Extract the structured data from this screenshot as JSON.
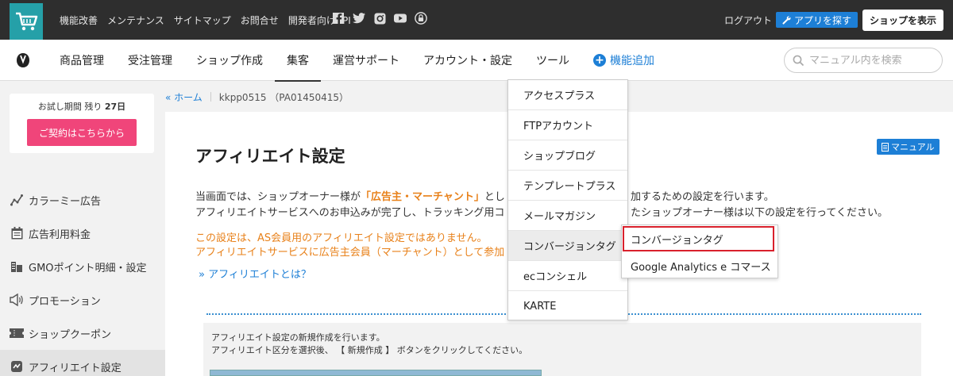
{
  "topbar": {
    "links": [
      "機能改善",
      "メンテナンス",
      "サイトマップ",
      "お問合せ",
      "開発者向けAPI"
    ],
    "sns_icons": [
      "facebook-icon",
      "twitter-icon",
      "instagram-icon",
      "youtube-icon",
      "lock-icon"
    ],
    "logout": "ログアウト",
    "app_button": "アプリを探す",
    "shop_button": "ショップを表示"
  },
  "nav": {
    "items": [
      "商品管理",
      "受注管理",
      "ショップ作成",
      "集客",
      "運営サポート",
      "アカウント・設定",
      "ツール"
    ],
    "active": "集客",
    "add_feature": "機能追加",
    "search_placeholder": "マニュアル内を検索"
  },
  "sidebar": {
    "trial_prefix": "お試し期間 残り",
    "trial_days": "27日",
    "contract_button": "ご契約はこちらから",
    "items": [
      {
        "label": "カラーミー広告",
        "icon": "chart-line-icon"
      },
      {
        "label": "広告利用料金",
        "icon": "calendar-icon"
      },
      {
        "label": "GMOポイント明細・設定",
        "icon": "coins-icon"
      },
      {
        "label": "プロモーション",
        "icon": "megaphone-icon"
      },
      {
        "label": "ショップクーポン",
        "icon": "coupon-icon"
      },
      {
        "label": "アフィリエイト設定",
        "icon": "affiliate-icon"
      }
    ],
    "active_item": "アフィリエイト設定"
  },
  "breadcrumb": {
    "home": "« ホーム",
    "current": "kkpp0515 （PA01450415）"
  },
  "main": {
    "title": "アフィリエイト設定",
    "manual_button": "マニュアル",
    "desc1_pre": "当画面では、ショップオーナー様が",
    "desc1_hl": "「広告主・マーチャント」",
    "desc1_post": "とし",
    "desc1_tail": "加するための設定を行います。",
    "desc2_pre": "アフィリエイトサービスへのお申込みが完了し、トラッキング用コ",
    "desc2_tail": "たショップオーナー様は以下の設定を行ってください。",
    "warn1": "この設定は、AS会員用のアフィリエイト設定ではありません。",
    "warn2": "アフィリエイトサービスに広告主会員（マーチャント）として参加",
    "whatis": "» アフィリエイトとは？",
    "info1": "アフィリエイト設定の新規作成を行います。",
    "info2": "アフィリエイト区分を選択後、 【 新規作成 】 ボタンをクリックしてください。"
  },
  "dropdown": {
    "items": [
      "アクセスプラス",
      "FTPアカウント",
      "ショップブログ",
      "テンプレートプラス",
      "メールマガジン",
      "コンバージョンタグ",
      "ecコンシェル",
      "KARTE"
    ],
    "hovered": "コンバージョンタグ"
  },
  "submenu": {
    "items": [
      "コンバージョンタグ",
      "Google Analytics e コマース"
    ],
    "highlighted": "コンバージョンタグ"
  },
  "colors": {
    "topbar_bg": "#2e2e2e",
    "logo_bg": "#25a0a8",
    "accent_blue": "#1d7fd6",
    "contract_pink": "#f0457a",
    "warning_orange": "#e8811a",
    "highlight_red": "#d9202c"
  }
}
